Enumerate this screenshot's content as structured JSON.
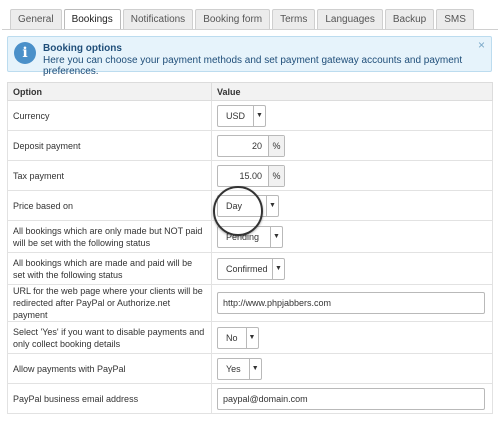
{
  "tabs": [
    "General",
    "Bookings",
    "Notifications",
    "Booking form",
    "Terms",
    "Languages",
    "Backup",
    "SMS"
  ],
  "info": {
    "title": "Booking options",
    "text": "Here you can choose your payment methods and set payment gateway accounts and payment preferences.",
    "close": "×"
  },
  "table": {
    "col_option": "Option",
    "col_value": "Value",
    "rows": [
      {
        "label": "Currency",
        "value": "USD"
      },
      {
        "label": "Deposit payment",
        "value": "20",
        "unit": "%"
      },
      {
        "label": "Tax payment",
        "value": "15.00",
        "unit": "%"
      },
      {
        "label": "Price based on",
        "value": "Day"
      },
      {
        "label": "All bookings which are only made but NOT paid will be set with the following status",
        "value": "Pending"
      },
      {
        "label": "All bookings which are made and paid will be set with the following status",
        "value": "Confirmed"
      },
      {
        "label": "URL for the web page where your clients will be redirected after PayPal or Authorize.net payment",
        "value": "http://www.phpjabbers.com"
      },
      {
        "label": "Select 'Yes' if you want to disable payments and only collect booking details",
        "value": "No"
      },
      {
        "label": "Allow payments with PayPal",
        "value": "Yes"
      },
      {
        "label": "PayPal business email address",
        "value": "paypal@domain.com"
      }
    ]
  },
  "arrow_glyph": "▼"
}
